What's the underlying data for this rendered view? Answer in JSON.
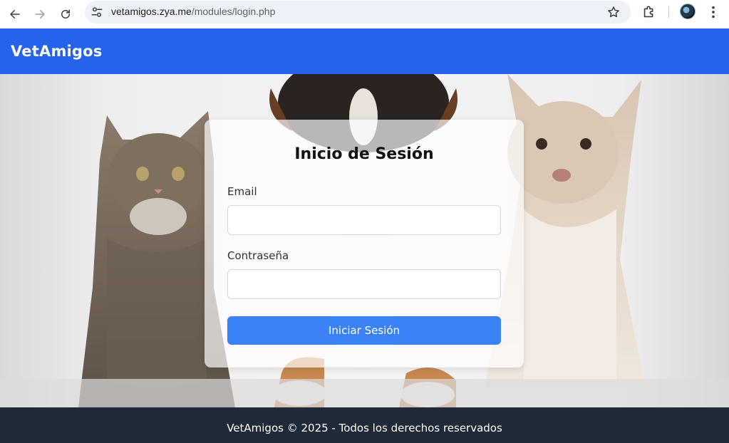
{
  "browser": {
    "url_host": "vetamigos.zya.me",
    "url_path": "/modules/login.php",
    "icons": {
      "back": "arrow-left-icon",
      "forward": "arrow-right-icon",
      "reload": "reload-icon",
      "site_info": "tune-icon",
      "bookmark": "star-icon",
      "extensions": "puzzle-icon",
      "profile": "avatar",
      "menu": "kebab-menu-icon"
    }
  },
  "header": {
    "brand": "VetAmigos",
    "color": "#2563eb"
  },
  "hero": {
    "image": "photo of a tabby cat, a tricolor dog and a light-colored puppy sitting side by side"
  },
  "login": {
    "title": "Inicio de Sesión",
    "email_label": "Email",
    "email_value": "",
    "password_label": "Contraseña",
    "password_value": "",
    "submit_label": "Iniciar Sesión",
    "button_color": "#3b82f6"
  },
  "footer": {
    "text": "VetAmigos © 2025 - Todos los derechos reservados",
    "color": "#1f2937"
  }
}
